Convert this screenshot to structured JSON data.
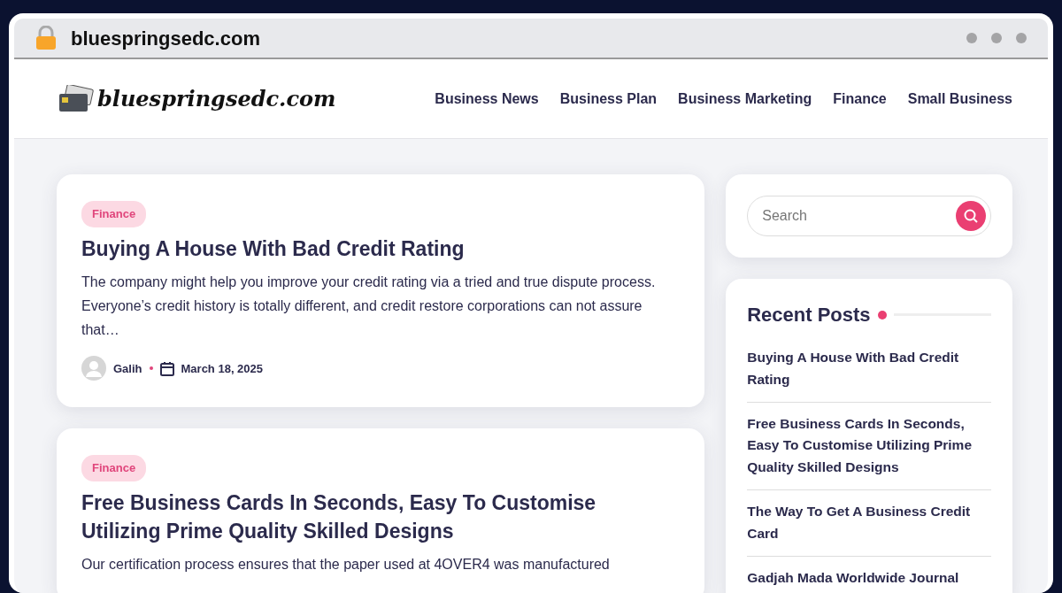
{
  "address_bar": {
    "url": "bluespringsedc.com"
  },
  "header": {
    "logo_text": "bluespringsedc.com",
    "nav": [
      {
        "label": "Business News"
      },
      {
        "label": "Business Plan"
      },
      {
        "label": "Business Marketing"
      },
      {
        "label": "Finance"
      },
      {
        "label": "Small Business"
      }
    ]
  },
  "posts": [
    {
      "category": "Finance",
      "title": "Buying A House With Bad Credit Rating",
      "excerpt": "The company might help you improve your credit rating via a tried and true dispute process. Everyone’s credit history is totally different, and credit restore corporations can not assure that…",
      "author": "Galih",
      "date": "March 18, 2025"
    },
    {
      "category": "Finance",
      "title": "Free Business Cards In Seconds, Easy To Customise Utilizing Prime Quality Skilled Designs",
      "excerpt": "Our certification process ensures that the paper used at 4OVER4 was manufactured"
    }
  ],
  "sidebar": {
    "search": {
      "placeholder": "Search"
    },
    "recent_posts": {
      "title": "Recent Posts",
      "items": [
        {
          "title": "Buying A House With Bad Credit Rating"
        },
        {
          "title": "Free Business Cards In Seconds, Easy To Customise Utilizing Prime Quality Skilled Designs"
        },
        {
          "title": "The Way To Get A Business Credit Card"
        },
        {
          "title": "Gadjah Mada Worldwide Journal"
        }
      ]
    }
  }
}
